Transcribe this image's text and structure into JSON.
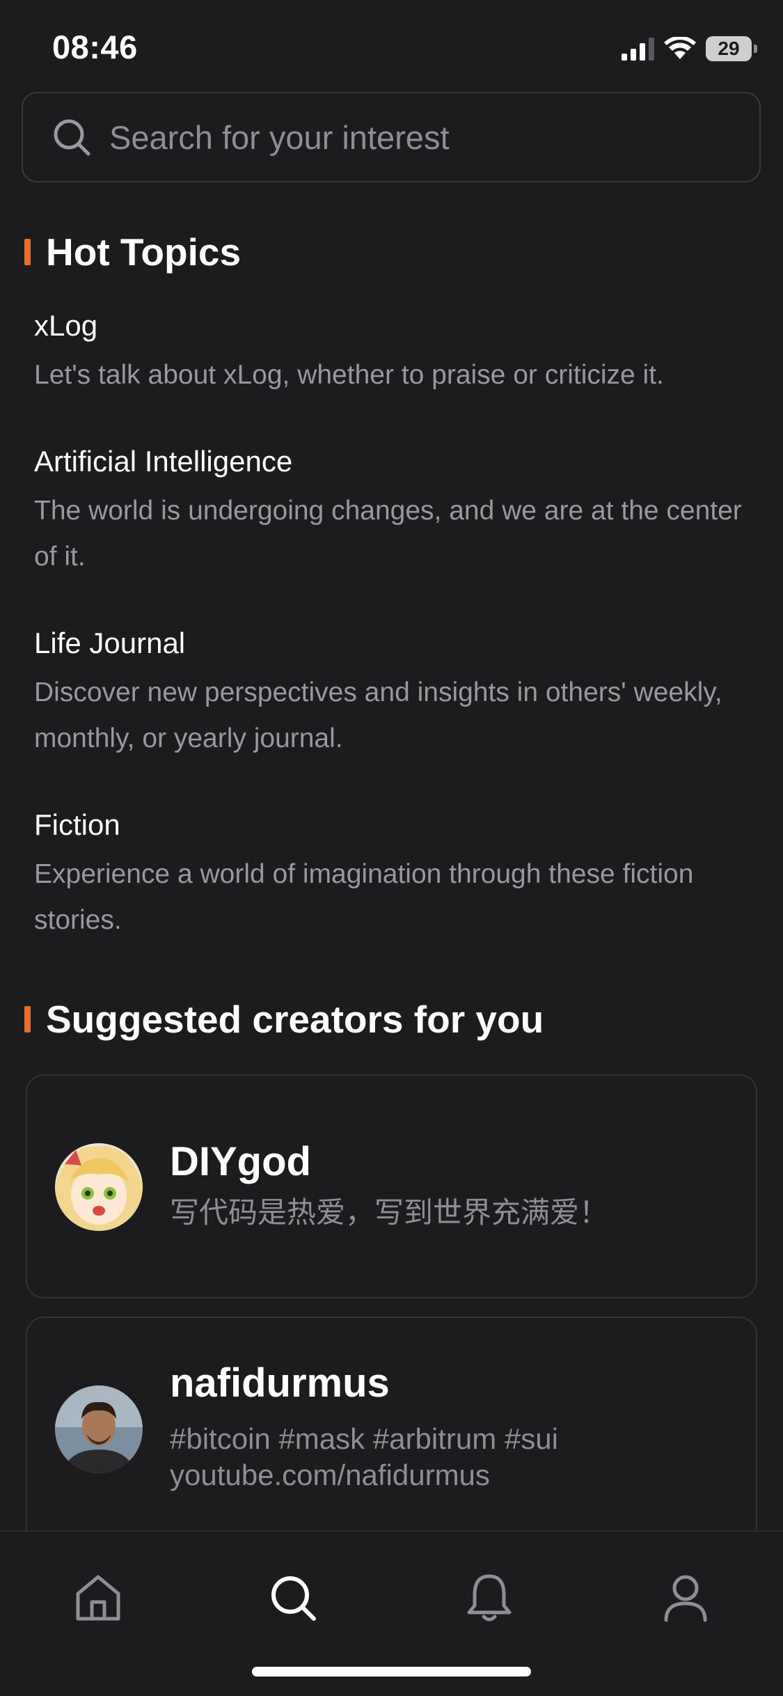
{
  "status_bar": {
    "time": "08:46",
    "battery": "29"
  },
  "search": {
    "placeholder": "Search for your interest"
  },
  "hot_topics": {
    "heading": "Hot Topics",
    "items": [
      {
        "title": "xLog",
        "description": "Let's talk about xLog, whether to praise or criticize it."
      },
      {
        "title": "Artificial Intelligence",
        "description": "The world is undergoing changes, and we are at the center of it."
      },
      {
        "title": "Life Journal",
        "description": "Discover new perspectives and insights in others' weekly, monthly, or yearly journal."
      },
      {
        "title": "Fiction",
        "description": "Experience a world of imagination through these fiction stories."
      }
    ]
  },
  "suggested_creators": {
    "heading": "Suggested creators for you",
    "items": [
      {
        "name": "DIYgod",
        "bio_lines": [
          "写代码是热爱，写到世界充满爱！"
        ]
      },
      {
        "name": "nafidurmus",
        "bio_lines": [
          "#bitcoin #mask #arbitrum #sui",
          "youtube.com/nafidurmus"
        ]
      }
    ]
  },
  "tab_bar": {
    "tabs": [
      {
        "name": "home",
        "icon": "home-icon",
        "active": false
      },
      {
        "name": "search",
        "icon": "search-icon",
        "active": true
      },
      {
        "name": "notifications",
        "icon": "bell-icon",
        "active": false
      },
      {
        "name": "profile",
        "icon": "user-icon",
        "active": false
      }
    ]
  },
  "colors": {
    "background": "#1c1c1e",
    "accent": "#f26a1b",
    "text_primary": "#ffffff",
    "text_secondary": "#98989d",
    "border": "#3a3a3c"
  }
}
